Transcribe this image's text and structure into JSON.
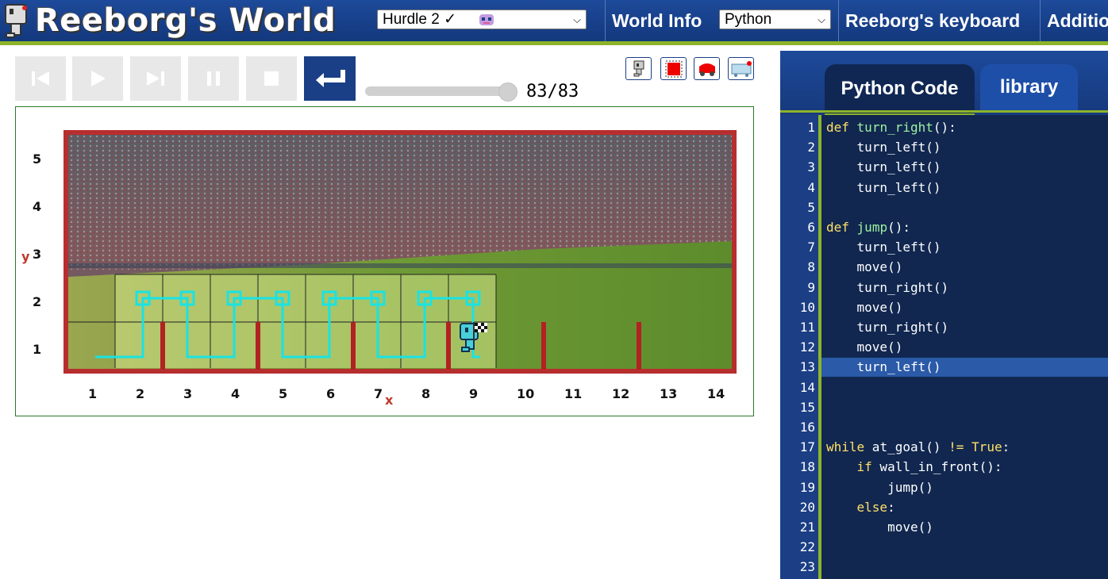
{
  "header": {
    "title": "Reeborg's World",
    "world_select": "Hurdle 2 ✓",
    "world_info": "World Info",
    "lang_select": "Python",
    "keyboard": "Reeborg's keyboard",
    "additional": "Additio"
  },
  "controls": {
    "counter": "83/83",
    "progress": 1.0
  },
  "world": {
    "y_axis_name": "y",
    "x_axis_name": "x",
    "y_labels": [
      "5",
      "4",
      "3",
      "2",
      "1"
    ],
    "x_labels": [
      "1",
      "2",
      "3",
      "4",
      "5",
      "6",
      "7",
      "8",
      "9",
      "10",
      "11",
      "12",
      "13",
      "14"
    ]
  },
  "editor": {
    "tab_active": "Python Code",
    "tab_other": "library",
    "highlighted_line": 13,
    "line_numbers": [
      "1",
      "2",
      "3",
      "4",
      "5",
      "6",
      "7",
      "8",
      "9",
      "10",
      "11",
      "12",
      "13",
      "14",
      "15",
      "16",
      "17",
      "18",
      "19",
      "20",
      "21",
      "22",
      "23"
    ],
    "lines": [
      "def turn_right():",
      "    turn_left()",
      "    turn_left()",
      "    turn_left()",
      "",
      "def jump():",
      "    turn_left()",
      "    move()",
      "    turn_right()",
      "    move()",
      "    turn_right()",
      "    move()",
      "    turn_left()",
      "",
      "",
      "",
      "while at_goal() != True:",
      "    if wall_in_front():",
      "        jump()",
      "    else:",
      "        move()",
      "",
      ""
    ]
  },
  "colors": {
    "header_bg": "#1d4a9a",
    "accent_green": "#8db32a",
    "wall_red": "#b22222",
    "trace_cyan": "#19e3e3"
  }
}
